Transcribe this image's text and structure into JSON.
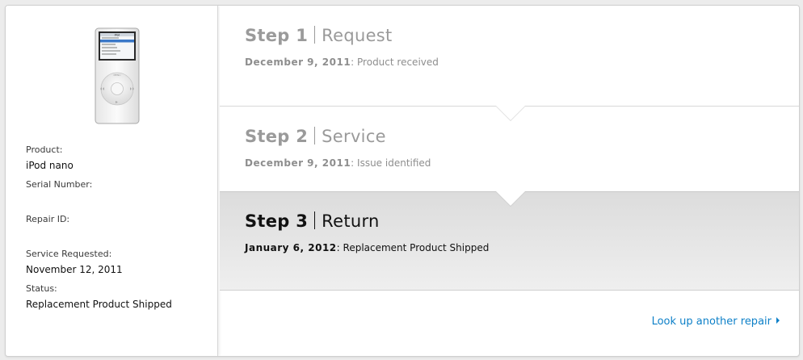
{
  "product_image": {
    "icon": "ipod-nano-icon",
    "screen_menu_title": "iPod"
  },
  "info": {
    "product_label": "Product:",
    "product_value": "iPod nano",
    "serial_label": "Serial Number:",
    "serial_value": "",
    "repair_id_label": "Repair ID:",
    "repair_id_value": "",
    "service_requested_label": "Service Requested:",
    "service_requested_value": "November 12, 2011",
    "status_label": "Status:",
    "status_value": "Replacement Product Shipped"
  },
  "steps": [
    {
      "step": "Step 1",
      "name": "Request",
      "date": "December 9, 2011",
      "detail": ": Product received"
    },
    {
      "step": "Step 2",
      "name": "Service",
      "date": "December 9, 2011",
      "detail": ": Issue identified"
    },
    {
      "step": "Step 3",
      "name": "Return",
      "date": "January 6, 2012",
      "detail": ": Replacement Product Shipped"
    }
  ],
  "lookup_link": {
    "label": "Look up another repair",
    "icon": "chevron-right-icon"
  },
  "colors": {
    "link": "#0e80c8",
    "muted_text": "#9a9a9a",
    "active_text": "#111111"
  }
}
